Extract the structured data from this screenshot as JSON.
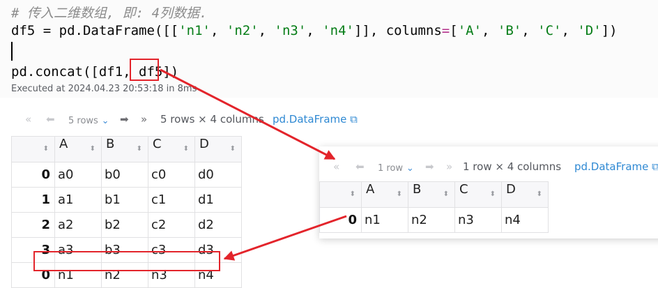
{
  "code": {
    "comment": "# 传入二维数组, 即: 4列数据.",
    "line2_var": "df5 = pd.DataFrame([[",
    "line2_vals": [
      "'n1'",
      "'n2'",
      "'n3'",
      "'n4'"
    ],
    "line2_mid": "]], columns",
    "line2_eq": "=",
    "line2_cols_open": "[",
    "line2_cols": [
      "'A'",
      "'B'",
      "'C'",
      "'D'"
    ],
    "line2_end": "])",
    "line3": "pd.concat([df1, df5])",
    "executed": "Executed at 2024.04.23 20:53:18 in 8ms"
  },
  "output1": {
    "first": "«",
    "prev": "⬅",
    "rows_selector": "5 rows",
    "next": "➡",
    "last": "»",
    "summary": "5 rows × 4 columns",
    "link": "pd.DataFrame",
    "columns": [
      "A",
      "B",
      "C",
      "D"
    ],
    "rows": [
      {
        "index": "0",
        "cells": [
          "a0",
          "b0",
          "c0",
          "d0"
        ]
      },
      {
        "index": "1",
        "cells": [
          "a1",
          "b1",
          "c1",
          "d1"
        ]
      },
      {
        "index": "2",
        "cells": [
          "a2",
          "b2",
          "c2",
          "d2"
        ]
      },
      {
        "index": "3",
        "cells": [
          "a3",
          "b3",
          "c3",
          "d3"
        ]
      },
      {
        "index": "0",
        "cells": [
          "n1",
          "n2",
          "n3",
          "n4"
        ]
      }
    ]
  },
  "output2": {
    "first": "«",
    "prev": "⬅",
    "rows_selector": "1 row",
    "next": "➡",
    "last": "»",
    "summary": "1 row × 4 columns",
    "link": "pd.DataFrame",
    "columns": [
      "A",
      "B",
      "C",
      "D"
    ],
    "rows": [
      {
        "index": "0",
        "cells": [
          "n1",
          "n2",
          "n3",
          "n4"
        ]
      }
    ]
  },
  "colors": {
    "annotation": "#e3242b",
    "link": "#2f89d3"
  }
}
